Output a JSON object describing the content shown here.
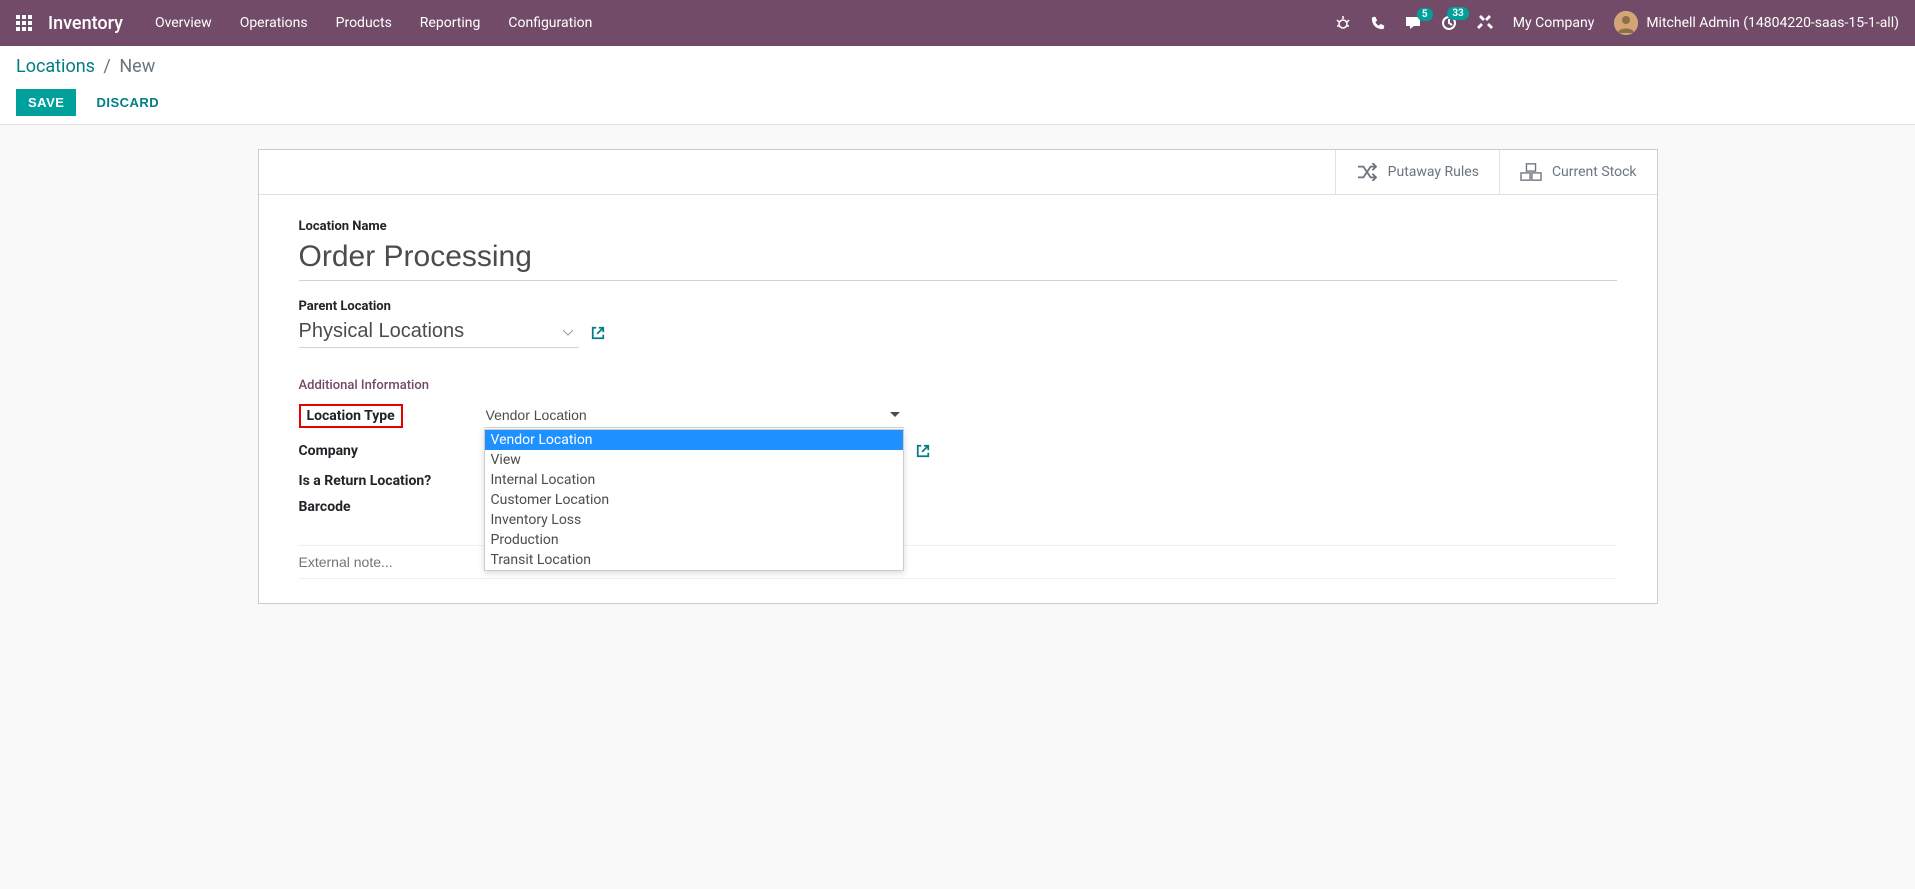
{
  "topbar": {
    "app_title": "Inventory",
    "menu": [
      "Overview",
      "Operations",
      "Products",
      "Reporting",
      "Configuration"
    ],
    "messages_count": "5",
    "activities_count": "33",
    "company": "My Company",
    "user": "Mitchell Admin (14804220-saas-15-1-all)"
  },
  "breadcrumb": {
    "parent": "Locations",
    "current": "New"
  },
  "buttons": {
    "save": "SAVE",
    "discard": "DISCARD"
  },
  "stat_buttons": {
    "putaway": "Putaway Rules",
    "stock": "Current Stock"
  },
  "form": {
    "location_name_label": "Location Name",
    "location_name_value": "Order Processing",
    "parent_location_label": "Parent Location",
    "parent_location_value": "Physical Locations",
    "section_title": "Additional Information",
    "location_type_label": "Location Type",
    "location_type_value": "Vendor Location",
    "location_type_options": [
      "Vendor Location",
      "View",
      "Internal Location",
      "Customer Location",
      "Inventory Loss",
      "Production",
      "Transit Location"
    ],
    "company_label": "Company",
    "return_label": "Is a Return Location?",
    "barcode_label": "Barcode",
    "note_placeholder": "External note..."
  }
}
